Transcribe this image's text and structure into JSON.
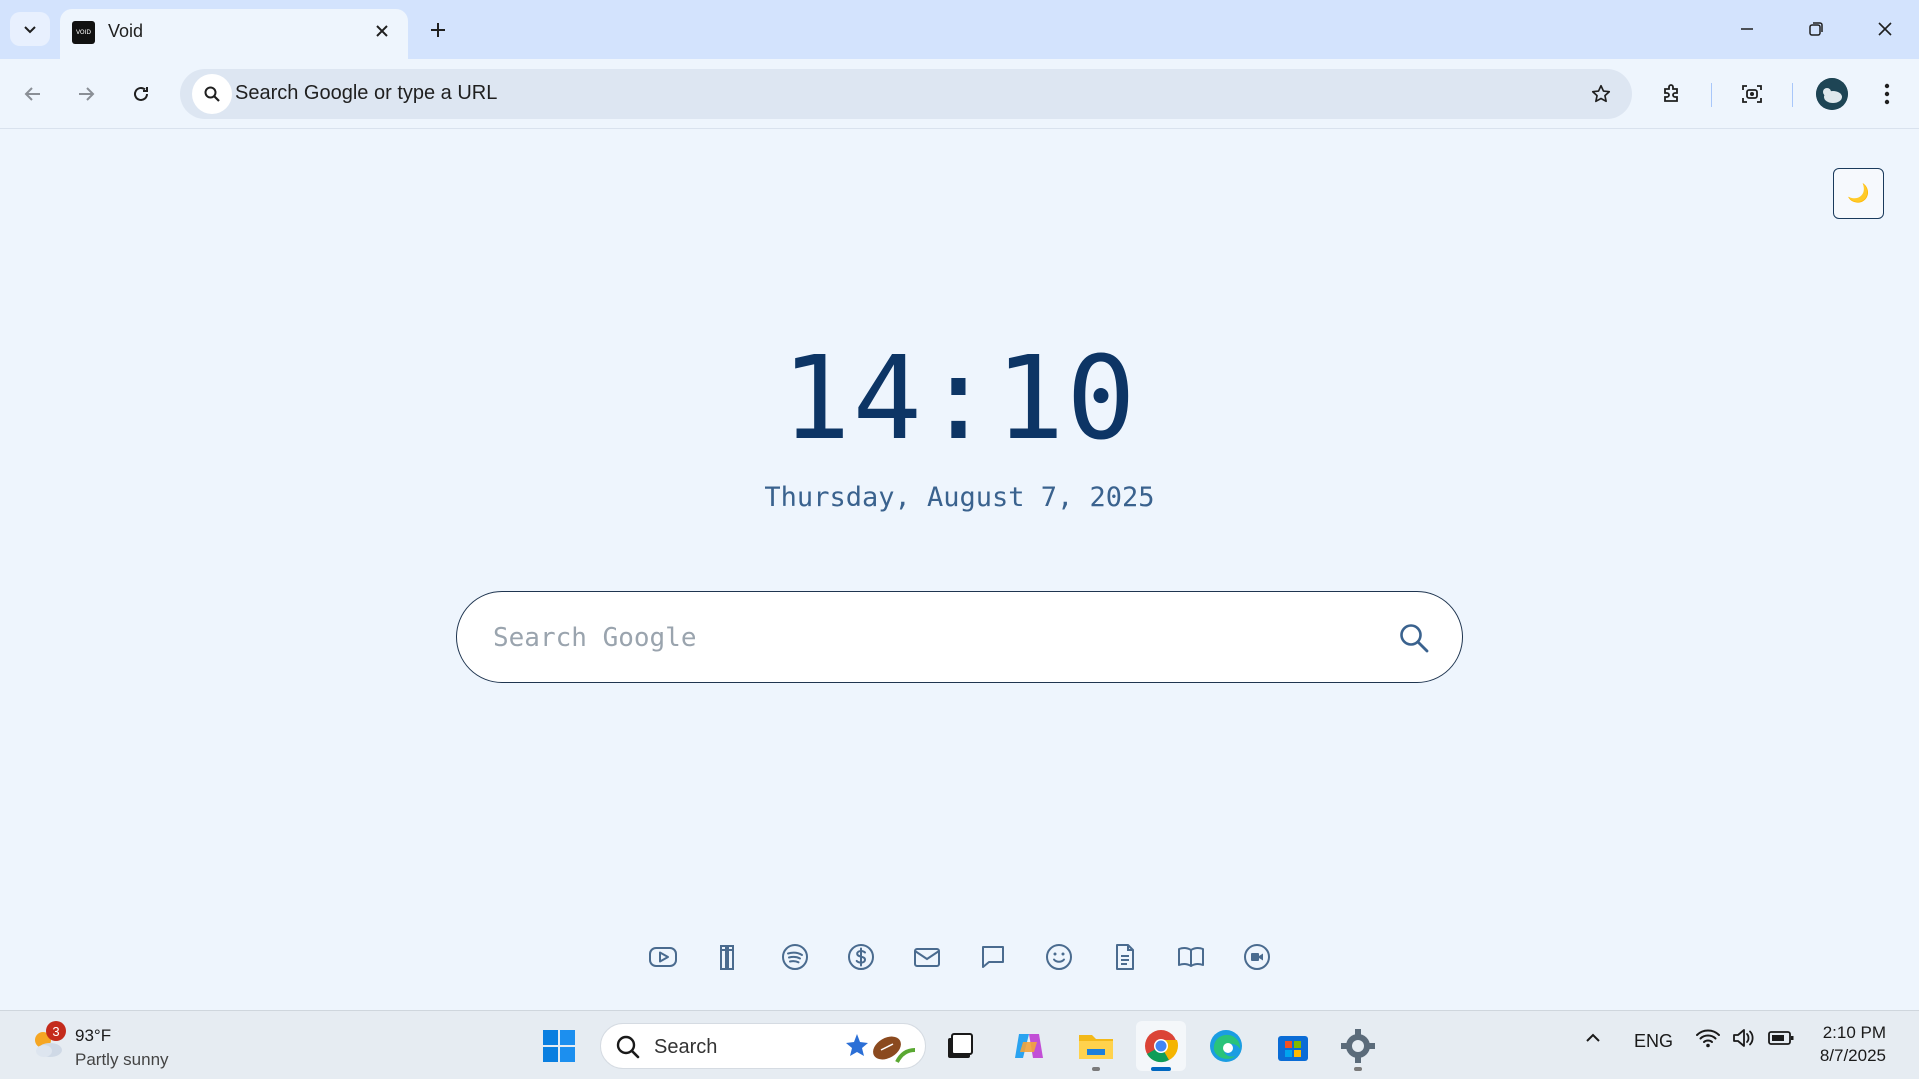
{
  "browser": {
    "tab": {
      "title": "Void",
      "favicon_text": "VOID"
    },
    "omnibox": {
      "placeholder": "Search Google or type a URL"
    },
    "icons": [
      "tab-search-icon",
      "close-icon",
      "plus-icon",
      "minimize-icon",
      "restore-icon",
      "close-window-icon",
      "back-arrow-icon",
      "forward-arrow-icon",
      "reload-icon",
      "search-icon",
      "star-icon",
      "extensions-icon",
      "screenshot-icon",
      "menu-dots-icon"
    ]
  },
  "page": {
    "theme_toggle_glyph": "🌙",
    "time": "14:10",
    "date": "Thursday, August 7, 2025",
    "search": {
      "placeholder": "Search Google"
    },
    "quick_links": [
      {
        "name": "youtube-icon"
      },
      {
        "name": "library-icon"
      },
      {
        "name": "spotify-icon"
      },
      {
        "name": "dollar-icon"
      },
      {
        "name": "mail-icon"
      },
      {
        "name": "chat-icon"
      },
      {
        "name": "smiley-icon"
      },
      {
        "name": "document-icon"
      },
      {
        "name": "book-icon"
      },
      {
        "name": "video-icon"
      }
    ],
    "accent_color": "#0d3565"
  },
  "taskbar": {
    "weather": {
      "badge": "3",
      "temp": "93°F",
      "desc": "Partly sunny"
    },
    "search_label": "Search",
    "tray": {
      "language": "ENG",
      "time": "2:10 PM",
      "date": "8/7/2025"
    }
  }
}
